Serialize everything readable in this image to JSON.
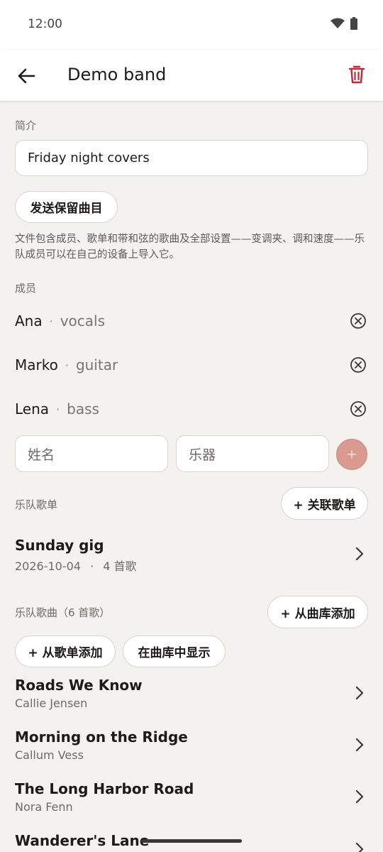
{
  "status": {
    "time": "12:00",
    "wifi_icon": "wifi-icon",
    "battery_icon": "battery-icon"
  },
  "app_bar": {
    "title": "Demo band",
    "back_icon": "arrow-back-icon",
    "delete_icon": "trash-icon",
    "delete_color": "#c0283b"
  },
  "intro": {
    "label": "简介",
    "value": "Friday night covers",
    "send_button": "发送保留曲目",
    "help": "文件包含成员、歌单和带和弦的歌曲及全部设置——变调夹、调和速度——乐队成员可以在自己的设备上导入它。"
  },
  "members": {
    "label": "成员",
    "items": [
      {
        "name": "Ana",
        "separator": "·",
        "instrument": "vocals"
      },
      {
        "name": "Marko",
        "separator": "·",
        "instrument": "guitar"
      },
      {
        "name": "Lena",
        "separator": "·",
        "instrument": "bass"
      }
    ],
    "name_placeholder": "姓名",
    "instrument_placeholder": "乐器",
    "add_icon": "plus-icon",
    "add_color": "#d99a92"
  },
  "setlists": {
    "label": "乐队歌单",
    "link_button": "+ 关联歌单",
    "items": [
      {
        "title": "Sunday gig",
        "date": "2026-10-04",
        "separator": "·",
        "count": "4 首歌"
      }
    ]
  },
  "songs": {
    "label": "乐队歌曲（6 首歌）",
    "add_from_library": "+ 从曲库添加",
    "add_from_setlist": "+ 从歌单添加",
    "show_in_library": "在曲库中显示",
    "items": [
      {
        "title": "Roads We Know",
        "artist": "Callie Jensen"
      },
      {
        "title": "Morning on the Ridge",
        "artist": "Callum Vess"
      },
      {
        "title": "The Long Harbor Road",
        "artist": "Nora Fenn"
      },
      {
        "title": "Wanderer's Lane",
        "artist": ""
      }
    ]
  }
}
